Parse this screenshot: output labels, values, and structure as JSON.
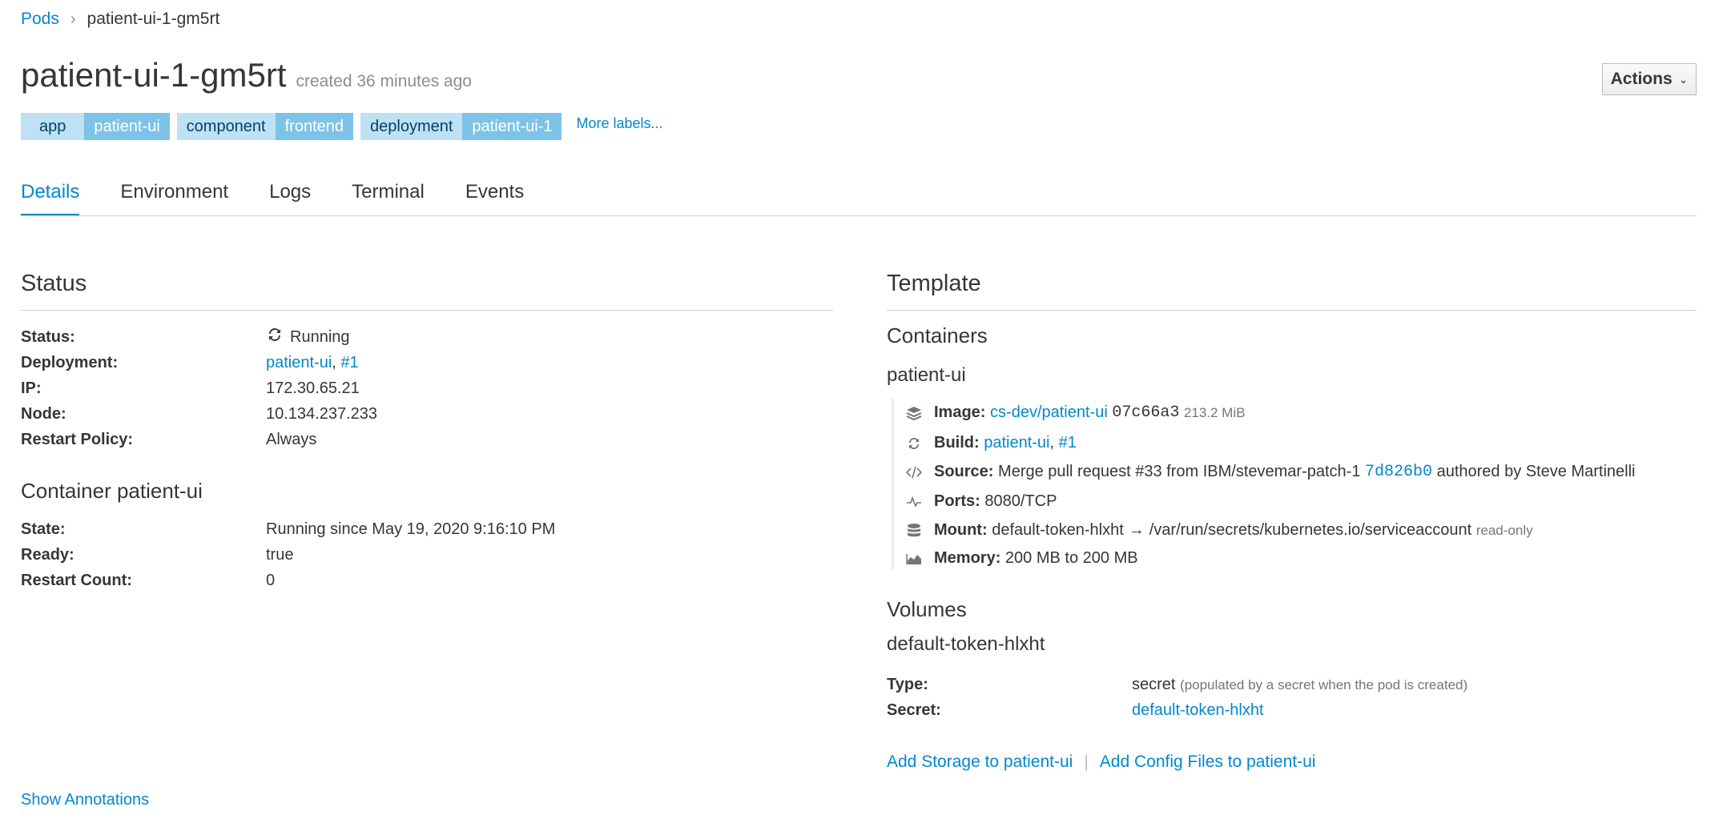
{
  "breadcrumb": {
    "parent": "Pods",
    "current": "patient-ui-1-gm5rt"
  },
  "header": {
    "title": "patient-ui-1-gm5rt",
    "created": "created 36 minutes ago",
    "actions_label": "Actions"
  },
  "labels": [
    {
      "key": "app",
      "value": "patient-ui"
    },
    {
      "key": "component",
      "value": "frontend"
    },
    {
      "key": "deployment",
      "value": "patient-ui-1"
    }
  ],
  "more_labels": "More labels...",
  "tabs": [
    "Details",
    "Environment",
    "Logs",
    "Terminal",
    "Events"
  ],
  "active_tab": "Details",
  "status": {
    "heading": "Status",
    "rows": {
      "status_key": "Status:",
      "status_val": "Running",
      "deployment_key": "Deployment:",
      "deployment_link": "patient-ui",
      "deployment_sep": ",",
      "deployment_num": "#1",
      "ip_key": "IP:",
      "ip_val": "172.30.65.21",
      "node_key": "Node:",
      "node_val": "10.134.237.233",
      "restart_key": "Restart Policy:",
      "restart_val": "Always"
    }
  },
  "container_state": {
    "heading": "Container patient-ui",
    "state_key": "State:",
    "state_val": "Running since May 19, 2020 9:16:10 PM",
    "ready_key": "Ready:",
    "ready_val": "true",
    "restart_key": "Restart Count:",
    "restart_val": "0"
  },
  "show_annotations": "Show Annotations",
  "template": {
    "heading": "Template",
    "containers_heading": "Containers",
    "container_name": "patient-ui",
    "image": {
      "key": "Image:",
      "link": "cs-dev/patient-ui",
      "hash": "07c66a3",
      "size": "213.2 MiB"
    },
    "build": {
      "key": "Build:",
      "link": "patient-ui",
      "sep": ",",
      "num": "#1"
    },
    "source": {
      "key": "Source:",
      "text": "Merge pull request #33 from IBM/stevemar-patch-1",
      "commit": "7d826b0",
      "author": "authored by Steve Martinelli"
    },
    "ports": {
      "key": "Ports:",
      "value": "8080/TCP"
    },
    "mount": {
      "key": "Mount:",
      "name": "default-token-hlxht",
      "arrow": "→",
      "path": "/var/run/secrets/kubernetes.io/serviceaccount",
      "mode": "read-only"
    },
    "memory": {
      "key": "Memory:",
      "value": "200 MB to 200 MB"
    },
    "volumes_heading": "Volumes",
    "volume_name": "default-token-hlxht",
    "type_key": "Type:",
    "type_val": "secret",
    "type_note": "(populated by a secret when the pod is created)",
    "secret_key": "Secret:",
    "secret_val": "default-token-hlxht",
    "add_storage": "Add Storage to patient-ui",
    "divider": "|",
    "add_config": "Add Config Files to patient-ui"
  },
  "icons": [
    "chevron-right-icon",
    "sync-icon",
    "layers-icon",
    "refresh-icon",
    "code-icon",
    "pulse-icon",
    "database-icon",
    "area-chart-icon",
    "caret-down-icon"
  ],
  "colors": {
    "link": "#0088ce",
    "label_key_bg": "#bee1f4",
    "label_val_bg": "#7dc3e8"
  }
}
